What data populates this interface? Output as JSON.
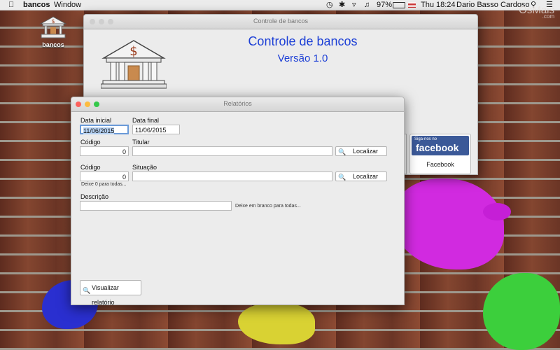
{
  "menubar": {
    "app_name": "bancos",
    "window_menu": "Window",
    "battery": "97%",
    "clock": "Thu 18:24",
    "user": "Dario Basso Cardoso"
  },
  "desktop": {
    "icon_label": "bancos",
    "watermark": "OsMais",
    "watermark_sub": ".com"
  },
  "main_window": {
    "title": "Controle de bancos",
    "heading": "Controle de bancos",
    "version": "Versão 1.0",
    "facebook_badge_top": "Siga-nos no",
    "facebook_badge_brand": "facebook",
    "facebook_label": "Facebook"
  },
  "report_window": {
    "title": "Relatórios",
    "data_inicial_label": "Data inicial",
    "data_inicial_value": "11/06/2015",
    "data_final_label": "Data final",
    "data_final_value": "11/06/2015",
    "codigo1_label": "Código",
    "codigo1_value": "0",
    "titular_label": "Titular",
    "titular_value": "",
    "localizar1": "Localizar",
    "codigo2_label": "Código",
    "codigo2_value": "0",
    "codigo2_hint": "Deixe 0 para todas...",
    "situacao_label": "Situação",
    "situacao_value": "",
    "localizar2": "Localizar",
    "descricao_label": "Descrição",
    "descricao_value": "",
    "descricao_hint": "Deixe em branco para todas...",
    "visualizar_button": "Visualizar relatório"
  },
  "colors": {
    "heading_blue": "#1c3fd6",
    "facebook_blue": "#3b5998",
    "close": "#fc605c",
    "minimize": "#fdbc40",
    "zoom": "#34c84a"
  }
}
